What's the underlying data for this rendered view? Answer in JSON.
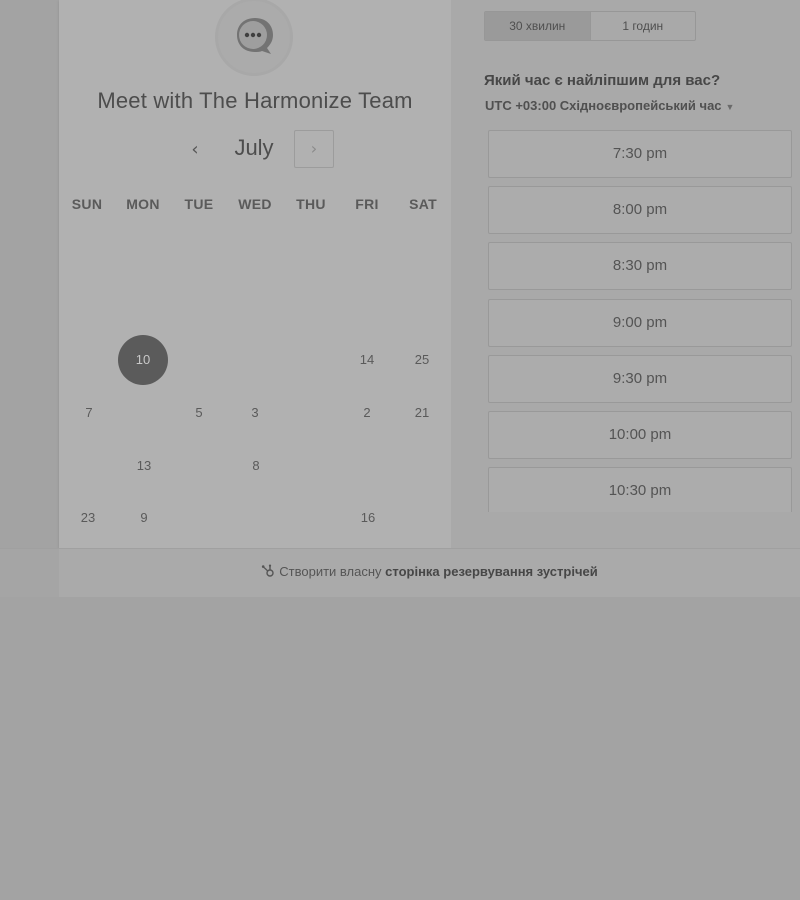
{
  "header": {
    "title": "Meet with The Harmonize Team"
  },
  "calendar": {
    "month": "July",
    "prev_label": "‹",
    "next_label": "›",
    "weekdays": [
      "SUN",
      "MON",
      "TUE",
      "WED",
      "THU",
      "FRI",
      "SAT"
    ],
    "selected_day": "10",
    "days": {
      "r1_fri": "14",
      "r1_sat": "25",
      "r2_sun": "7",
      "r2_tue": "5",
      "r2_wed": "3",
      "r2_fri": "2",
      "r2_sat": "21",
      "r3_mon": "13",
      "r3_wed": "8",
      "r4_sun": "23",
      "r4_mon": "9",
      "r4_fri": "16"
    }
  },
  "duration": {
    "options": [
      "30 хвилин",
      "1 годин"
    ],
    "selected": "30 хвилин"
  },
  "question": "Який час є найліпшим для вас?",
  "timezone": {
    "offset": "UTC +03:00",
    "name": "Східноєвропейський час"
  },
  "time_slots": [
    "7:30 pm",
    "8:00 pm",
    "8:30 pm",
    "9:00 pm",
    "9:30 pm",
    "10:00 pm",
    "10:30 pm"
  ],
  "footer": {
    "prefix": "Створити власну",
    "link": "сторінка резервування зустрічей"
  },
  "colors": {
    "background": "#a3a3a3",
    "selected_day": "#5b5b5b"
  }
}
